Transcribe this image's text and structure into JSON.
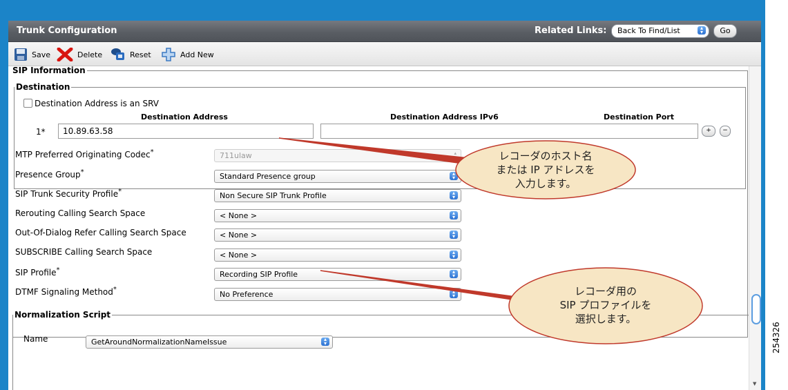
{
  "header": {
    "title": "Trunk Configuration",
    "related_links_label": "Related Links:",
    "related_links_value": "Back To Find/List",
    "go_label": "Go"
  },
  "toolbar": {
    "save": "Save",
    "delete": "Delete",
    "reset": "Reset",
    "add_new": "Add New"
  },
  "sip_info": {
    "legend": "SIP Information",
    "destination": {
      "legend": "Destination",
      "srv_label": "Destination Address is an SRV",
      "srv_checked": false,
      "col_address": "Destination Address",
      "col_ipv6": "Destination Address IPv6",
      "col_port": "Destination Port",
      "row_index": "1*",
      "address_value": "10.89.63.58",
      "ipv6_value": "",
      "port_value": ""
    },
    "fields": [
      {
        "label": "MTP Preferred Originating Codec",
        "required": true,
        "value": "711ulaw",
        "disabled": true
      },
      {
        "label": "Presence Group",
        "required": true,
        "value": "Standard Presence group"
      },
      {
        "label": "SIP Trunk Security Profile",
        "required": true,
        "value": "Non Secure SIP Trunk Profile"
      },
      {
        "label": "Rerouting Calling Search Space",
        "required": false,
        "value": "< None >"
      },
      {
        "label": "Out-Of-Dialog Refer Calling Search Space",
        "required": false,
        "value": "< None >"
      },
      {
        "label": "SUBSCRIBE Calling Search Space",
        "required": false,
        "value": "< None >"
      },
      {
        "label": "SIP Profile",
        "required": true,
        "value": "Recording SIP Profile"
      },
      {
        "label": "DTMF Signaling Method",
        "required": true,
        "value": "No Preference"
      }
    ]
  },
  "normalization": {
    "legend": "Normalization Script",
    "name_label": "Name",
    "name_value": "GetAroundNormalizationNameIssue"
  },
  "callouts": {
    "host": [
      "レコーダのホスト名",
      "または IP アドレスを",
      "入力します。"
    ],
    "profile": [
      "レコーダ用の",
      "SIP プロファイルを",
      "選択します。"
    ]
  },
  "required_mark": "*",
  "image_id": "254326",
  "colors": {
    "frame": "#1b84c8",
    "callout_fill": "#f7e6c4",
    "callout_stroke": "#c0392b",
    "titlebar": "#5a5e64"
  }
}
